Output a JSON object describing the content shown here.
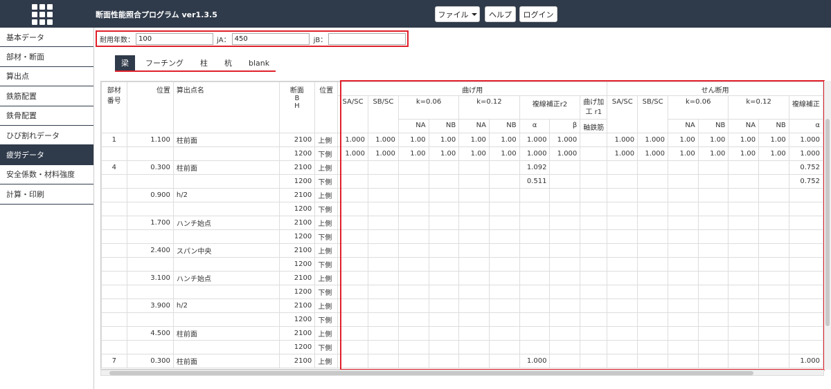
{
  "header": {
    "title": "断面性能照合プログラム ver1.3.5",
    "buttons": {
      "file": "ファイル",
      "help": "ヘルプ",
      "login": "ログイン"
    }
  },
  "sidebar": {
    "items": [
      "基本データ",
      "部材・断面",
      "算出点",
      "鉄筋配置",
      "鉄骨配置",
      "ひび割れデータ",
      "疲労データ",
      "安全係数・材料強度",
      "計算・印刷"
    ],
    "active_index": 6
  },
  "params": {
    "life_label": "耐用年数：",
    "life_value": "100",
    "ja_label": "jA：",
    "ja_value": "450",
    "jb_label": "jB：",
    "jb_value": ""
  },
  "tabs": [
    "梁",
    "フーチング",
    "柱",
    "杭",
    "blank"
  ],
  "table": {
    "head": {
      "member": "部材\n番号",
      "position": "位置",
      "calc_point": "算出点名",
      "section": "断面\nB\nH",
      "side": "位置",
      "bending": "曲げ用",
      "shear": "せん断用",
      "sasc": "SA/SC",
      "sbsc": "SB/SC",
      "k006": "k=0.06",
      "k012": "k=0.12",
      "r2": "複線補正r2",
      "r1": "曲げ加工 r1",
      "axial": "軸鉄筋",
      "na": "NA",
      "nb": "NB",
      "alpha": "α",
      "beta": "β",
      "shear_r2": "複線補正"
    },
    "rows": [
      [
        "1",
        "1.100",
        "柱前面",
        "2100",
        "上側",
        "1.000",
        "1.000",
        "1.00",
        "1.00",
        "1.00",
        "1.00",
        "1.000",
        "1.000",
        "",
        "1.000",
        "1.000",
        "1.00",
        "1.00",
        "1.00",
        "1.00",
        "1.000"
      ],
      [
        "",
        "",
        "",
        "1200",
        "下側",
        "1.000",
        "1.000",
        "1.00",
        "1.00",
        "1.00",
        "1.00",
        "1.000",
        "1.000",
        "",
        "1.000",
        "1.000",
        "1.00",
        "1.00",
        "1.00",
        "1.00",
        "1.000"
      ],
      [
        "4",
        "0.300",
        "柱前面",
        "2100",
        "上側",
        "",
        "",
        "",
        "",
        "",
        "",
        "1.092",
        "",
        "",
        "",
        "",
        "",
        "",
        "",
        "",
        "0.752"
      ],
      [
        "",
        "",
        "",
        "1200",
        "下側",
        "",
        "",
        "",
        "",
        "",
        "",
        "0.511",
        "",
        "",
        "",
        "",
        "",
        "",
        "",
        "",
        "0.752"
      ],
      [
        "",
        "0.900",
        "h/2",
        "2100",
        "上側",
        "",
        "",
        "",
        "",
        "",
        "",
        "",
        "",
        "",
        "",
        "",
        "",
        "",
        "",
        "",
        ""
      ],
      [
        "",
        "",
        "",
        "1200",
        "下側",
        "",
        "",
        "",
        "",
        "",
        "",
        "",
        "",
        "",
        "",
        "",
        "",
        "",
        "",
        "",
        ""
      ],
      [
        "",
        "1.700",
        "ハンチ始点",
        "2100",
        "上側",
        "",
        "",
        "",
        "",
        "",
        "",
        "",
        "",
        "",
        "",
        "",
        "",
        "",
        "",
        "",
        ""
      ],
      [
        "",
        "",
        "",
        "1200",
        "下側",
        "",
        "",
        "",
        "",
        "",
        "",
        "",
        "",
        "",
        "",
        "",
        "",
        "",
        "",
        "",
        ""
      ],
      [
        "",
        "2.400",
        "スパン中央",
        "2100",
        "上側",
        "",
        "",
        "",
        "",
        "",
        "",
        "",
        "",
        "",
        "",
        "",
        "",
        "",
        "",
        "",
        ""
      ],
      [
        "",
        "",
        "",
        "1200",
        "下側",
        "",
        "",
        "",
        "",
        "",
        "",
        "",
        "",
        "",
        "",
        "",
        "",
        "",
        "",
        "",
        ""
      ],
      [
        "",
        "3.100",
        "ハンチ始点",
        "2100",
        "上側",
        "",
        "",
        "",
        "",
        "",
        "",
        "",
        "",
        "",
        "",
        "",
        "",
        "",
        "",
        "",
        ""
      ],
      [
        "",
        "",
        "",
        "1200",
        "下側",
        "",
        "",
        "",
        "",
        "",
        "",
        "",
        "",
        "",
        "",
        "",
        "",
        "",
        "",
        "",
        ""
      ],
      [
        "",
        "3.900",
        "h/2",
        "2100",
        "上側",
        "",
        "",
        "",
        "",
        "",
        "",
        "",
        "",
        "",
        "",
        "",
        "",
        "",
        "",
        "",
        ""
      ],
      [
        "",
        "",
        "",
        "1200",
        "下側",
        "",
        "",
        "",
        "",
        "",
        "",
        "",
        "",
        "",
        "",
        "",
        "",
        "",
        "",
        "",
        ""
      ],
      [
        "",
        "4.500",
        "柱前面",
        "2100",
        "上側",
        "",
        "",
        "",
        "",
        "",
        "",
        "",
        "",
        "",
        "",
        "",
        "",
        "",
        "",
        "",
        ""
      ],
      [
        "",
        "",
        "",
        "1200",
        "下側",
        "",
        "",
        "",
        "",
        "",
        "",
        "",
        "",
        "",
        "",
        "",
        "",
        "",
        "",
        "",
        ""
      ],
      [
        "7",
        "0.300",
        "柱前面",
        "2100",
        "上側",
        "",
        "",
        "",
        "",
        "",
        "",
        "1.000",
        "",
        "",
        "",
        "",
        "",
        "",
        "",
        "",
        "1.000"
      ]
    ]
  }
}
